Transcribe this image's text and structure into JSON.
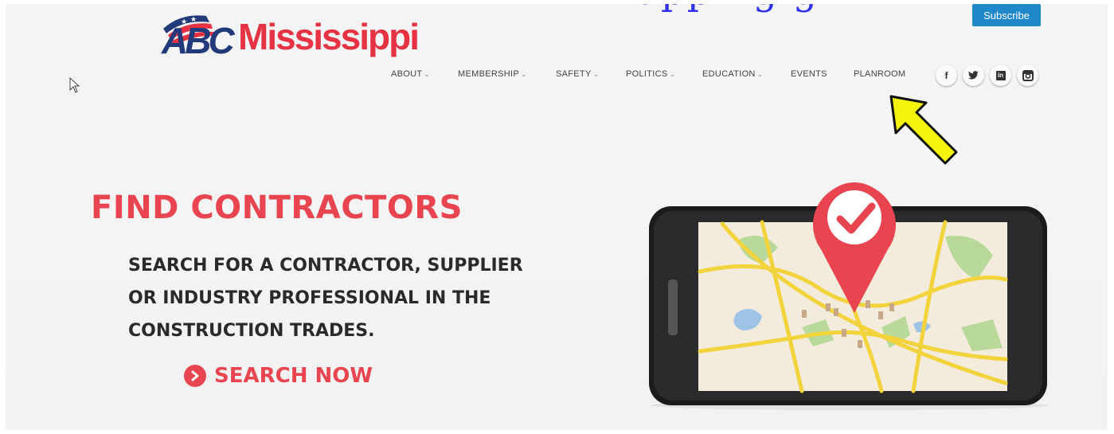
{
  "overlay": {
    "text": "upping g"
  },
  "logo": {
    "abc": "ABC",
    "name": "Mississippi"
  },
  "header": {
    "subscribe_label": "Subscribe"
  },
  "nav": {
    "items": [
      {
        "label": "ABOUT",
        "dropdown": true
      },
      {
        "label": "MEMBERSHIP",
        "dropdown": true
      },
      {
        "label": "SAFETY",
        "dropdown": true
      },
      {
        "label": "POLITICS",
        "dropdown": true
      },
      {
        "label": "EDUCATION",
        "dropdown": true
      },
      {
        "label": "EVENTS",
        "dropdown": false
      },
      {
        "label": "PLANROOM",
        "dropdown": false
      }
    ],
    "chevron": "⌄"
  },
  "social": {
    "facebook": "f",
    "twitter": "twitter-icon",
    "linkedin": "in",
    "instagram": "instagram-icon"
  },
  "hero": {
    "title": "FIND CONTRACTORS",
    "body_lines": [
      "SEARCH FOR A CONTRACTOR, SUPPLIER",
      "OR INDUSTRY PROFESSIONAL IN THE",
      "CONSTRUCTION TRADES."
    ],
    "cta": "SEARCH NOW"
  },
  "colors": {
    "brand_red": "#e84550",
    "brand_blue": "#233a7a",
    "subscribe_blue": "#1e88c9",
    "highlight_arrow": "#f5f30a"
  }
}
